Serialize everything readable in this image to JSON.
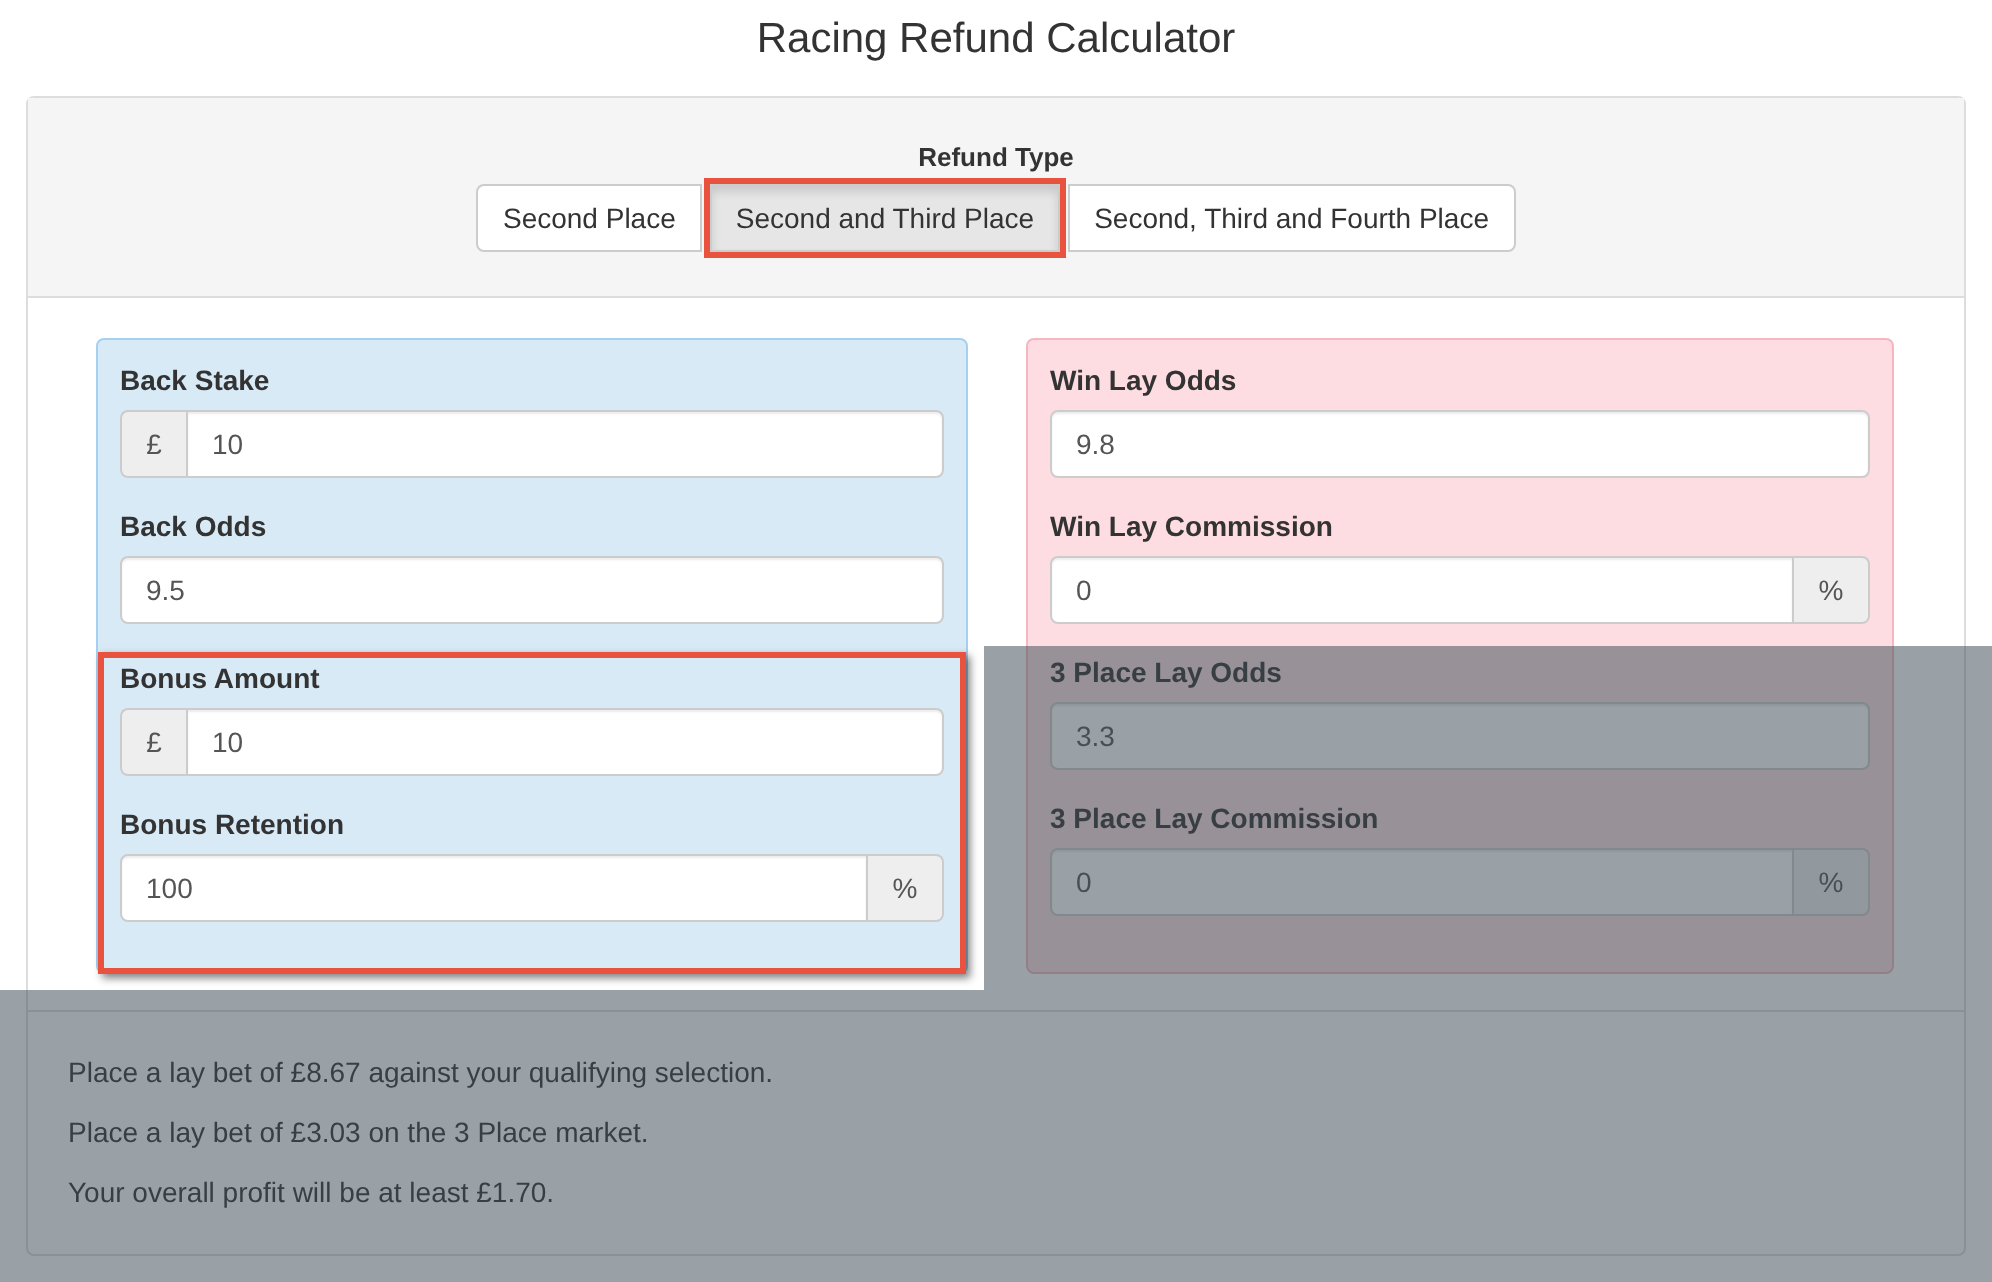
{
  "title": "Racing Refund Calculator",
  "refund_type": {
    "label": "Refund Type",
    "options": [
      {
        "label": "Second Place",
        "selected": false,
        "highlighted": false
      },
      {
        "label": "Second and Third Place",
        "selected": true,
        "highlighted": true
      },
      {
        "label": "Second, Third and Fourth Place",
        "selected": false,
        "highlighted": false
      }
    ]
  },
  "back_panel": {
    "groups": [
      {
        "highlighted": false,
        "fields": [
          {
            "label": "Back Stake",
            "prefix": "£",
            "value": "10"
          },
          {
            "label": "Back Odds",
            "value": "9.5"
          }
        ]
      },
      {
        "highlighted": true,
        "fields": [
          {
            "label": "Bonus Amount",
            "prefix": "£",
            "value": "10"
          },
          {
            "label": "Bonus Retention",
            "value": "100",
            "suffix": "%"
          }
        ]
      }
    ]
  },
  "lay_panel": {
    "fields": [
      {
        "label": "Win Lay Odds",
        "value": "9.8"
      },
      {
        "label": "Win Lay Commission",
        "value": "0",
        "suffix": "%"
      },
      {
        "label": "3 Place Lay Odds",
        "value": "3.3"
      },
      {
        "label": "3 Place Lay Commission",
        "value": "0",
        "suffix": "%"
      }
    ]
  },
  "results": [
    "Place a lay bet of £8.67 against your qualifying selection.",
    "Place a lay bet of £3.03 on the 3 Place market.",
    "Your overall profit will be at least £1.70."
  ],
  "spotlight": {
    "on": true
  }
}
